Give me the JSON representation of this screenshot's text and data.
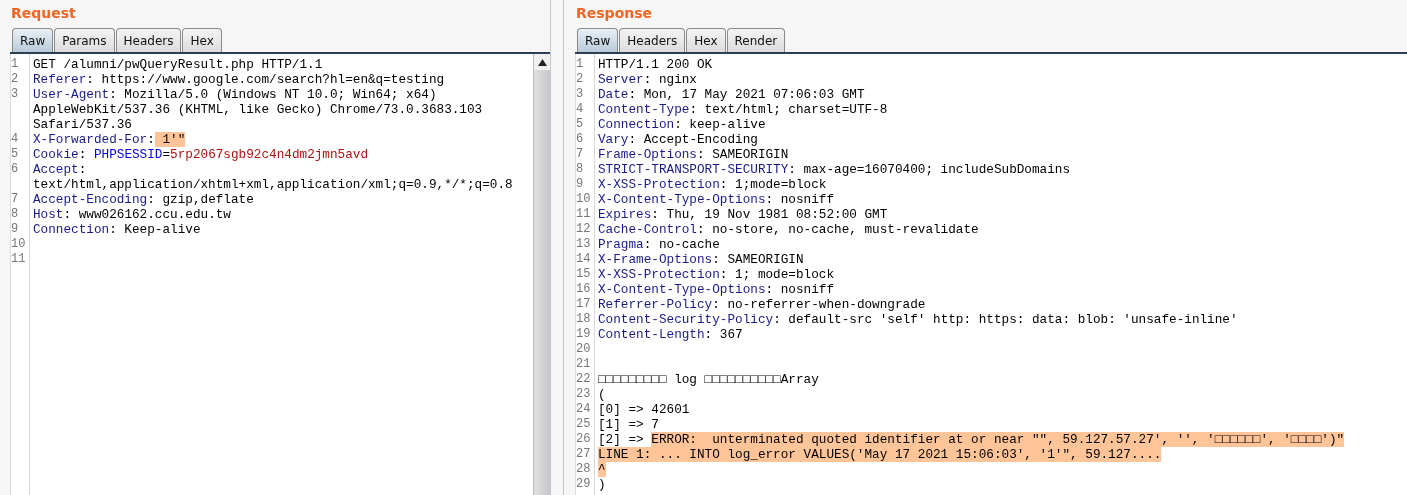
{
  "panes": [
    {
      "title": "Request",
      "scrollbar": true,
      "tabs": [
        {
          "label": "Raw",
          "selected": true
        },
        {
          "label": "Params",
          "selected": false
        },
        {
          "label": "Headers",
          "selected": false
        },
        {
          "label": "Hex",
          "selected": false
        }
      ],
      "lines": [
        {
          "number": "1",
          "rows": [
            [
              {
                "kind": "plain",
                "text": "GET /alumni/pwQueryResult.php HTTP/1.1"
              }
            ]
          ]
        },
        {
          "number": "2",
          "rows": [
            [
              {
                "kind": "name",
                "text": "Referer"
              },
              {
                "kind": "plain",
                "text": ": https://www.google.com/search?hl=en&q=testing"
              }
            ]
          ]
        },
        {
          "number": "3",
          "rows": [
            [
              {
                "kind": "name",
                "text": "User-Agent"
              },
              {
                "kind": "plain",
                "text": ": Mozilla/5.0 (Windows NT 10.0; Win64; x64)"
              }
            ],
            [
              {
                "kind": "plain",
                "text": "AppleWebKit/537.36 (KHTML, like Gecko) Chrome/73.0.3683.103"
              }
            ],
            [
              {
                "kind": "plain",
                "text": "Safari/537.36"
              }
            ]
          ]
        },
        {
          "number": "4",
          "rows": [
            [
              {
                "kind": "name",
                "text": "X-Forwarded-For"
              },
              {
                "kind": "plain",
                "text": ":"
              },
              {
                "kind": "highlight",
                "text": " 1'\""
              }
            ]
          ]
        },
        {
          "number": "5",
          "rows": [
            [
              {
                "kind": "name",
                "text": "Cookie"
              },
              {
                "kind": "plain",
                "text": ": "
              },
              {
                "kind": "param",
                "text": "PHPSESSID"
              },
              {
                "kind": "plain",
                "text": "="
              },
              {
                "kind": "value",
                "text": "5rp2067sgb92c4n4dm2jmn5avd"
              }
            ]
          ]
        },
        {
          "number": "6",
          "rows": [
            [
              {
                "kind": "name",
                "text": "Accept"
              },
              {
                "kind": "plain",
                "text": ":"
              }
            ],
            [
              {
                "kind": "plain",
                "text": "text/html,application/xhtml+xml,application/xml;q=0.9,*/*;q=0.8"
              }
            ]
          ]
        },
        {
          "number": "7",
          "rows": [
            [
              {
                "kind": "name",
                "text": "Accept-Encoding"
              },
              {
                "kind": "plain",
                "text": ": gzip,deflate"
              }
            ]
          ]
        },
        {
          "number": "8",
          "rows": [
            [
              {
                "kind": "name",
                "text": "Host"
              },
              {
                "kind": "plain",
                "text": ": www026162.ccu.edu.tw"
              }
            ]
          ]
        },
        {
          "number": "9",
          "rows": [
            [
              {
                "kind": "name",
                "text": "Connection"
              },
              {
                "kind": "plain",
                "text": ": Keep-alive"
              }
            ]
          ]
        },
        {
          "number": "10",
          "rows": [
            []
          ]
        },
        {
          "number": "11",
          "rows": [
            []
          ]
        }
      ]
    },
    {
      "title": "Response",
      "scrollbar": false,
      "tabs": [
        {
          "label": "Raw",
          "selected": true
        },
        {
          "label": "Headers",
          "selected": false
        },
        {
          "label": "Hex",
          "selected": false
        },
        {
          "label": "Render",
          "selected": false
        }
      ],
      "lines": [
        {
          "number": "1",
          "rows": [
            [
              {
                "kind": "plain",
                "text": "HTTP/1.1 200 OK"
              }
            ]
          ]
        },
        {
          "number": "2",
          "rows": [
            [
              {
                "kind": "name",
                "text": "Server"
              },
              {
                "kind": "plain",
                "text": ": nginx"
              }
            ]
          ]
        },
        {
          "number": "3",
          "rows": [
            [
              {
                "kind": "name",
                "text": "Date"
              },
              {
                "kind": "plain",
                "text": ": Mon, 17 May 2021 07:06:03 GMT"
              }
            ]
          ]
        },
        {
          "number": "4",
          "rows": [
            [
              {
                "kind": "name",
                "text": "Content-Type"
              },
              {
                "kind": "plain",
                "text": ": text/html; charset=UTF-8"
              }
            ]
          ]
        },
        {
          "number": "5",
          "rows": [
            [
              {
                "kind": "name",
                "text": "Connection"
              },
              {
                "kind": "plain",
                "text": ": keep-alive"
              }
            ]
          ]
        },
        {
          "number": "6",
          "rows": [
            [
              {
                "kind": "name",
                "text": "Vary"
              },
              {
                "kind": "plain",
                "text": ": Accept-Encoding"
              }
            ]
          ]
        },
        {
          "number": "7",
          "rows": [
            [
              {
                "kind": "name",
                "text": "Frame-Options"
              },
              {
                "kind": "plain",
                "text": ": SAMEORIGIN"
              }
            ]
          ]
        },
        {
          "number": "8",
          "rows": [
            [
              {
                "kind": "name",
                "text": "STRICT-TRANSPORT-SECURITY"
              },
              {
                "kind": "plain",
                "text": ": max-age=16070400; includeSubDomains"
              }
            ]
          ]
        },
        {
          "number": "9",
          "rows": [
            [
              {
                "kind": "name",
                "text": "X-XSS-Protection"
              },
              {
                "kind": "plain",
                "text": ": 1;mode=block"
              }
            ]
          ]
        },
        {
          "number": "10",
          "rows": [
            [
              {
                "kind": "name",
                "text": "X-Content-Type-Options"
              },
              {
                "kind": "plain",
                "text": ": nosniff"
              }
            ]
          ]
        },
        {
          "number": "11",
          "rows": [
            [
              {
                "kind": "name",
                "text": "Expires"
              },
              {
                "kind": "plain",
                "text": ": Thu, 19 Nov 1981 08:52:00 GMT"
              }
            ]
          ]
        },
        {
          "number": "12",
          "rows": [
            [
              {
                "kind": "name",
                "text": "Cache-Control"
              },
              {
                "kind": "plain",
                "text": ": no-store, no-cache, must-revalidate"
              }
            ]
          ]
        },
        {
          "number": "13",
          "rows": [
            [
              {
                "kind": "name",
                "text": "Pragma"
              },
              {
                "kind": "plain",
                "text": ": no-cache"
              }
            ]
          ]
        },
        {
          "number": "14",
          "rows": [
            [
              {
                "kind": "name",
                "text": "X-Frame-Options"
              },
              {
                "kind": "plain",
                "text": ": SAMEORIGIN"
              }
            ]
          ]
        },
        {
          "number": "15",
          "rows": [
            [
              {
                "kind": "name",
                "text": "X-XSS-Protection"
              },
              {
                "kind": "plain",
                "text": ": 1; mode=block"
              }
            ]
          ]
        },
        {
          "number": "16",
          "rows": [
            [
              {
                "kind": "name",
                "text": "X-Content-Type-Options"
              },
              {
                "kind": "plain",
                "text": ": nosniff"
              }
            ]
          ]
        },
        {
          "number": "17",
          "rows": [
            [
              {
                "kind": "name",
                "text": "Referrer-Policy"
              },
              {
                "kind": "plain",
                "text": ": no-referrer-when-downgrade"
              }
            ]
          ]
        },
        {
          "number": "18",
          "rows": [
            [
              {
                "kind": "name",
                "text": "Content-Security-Policy"
              },
              {
                "kind": "plain",
                "text": ": default-src 'self' http: https: data: blob: 'unsafe-inline'"
              }
            ]
          ]
        },
        {
          "number": "19",
          "rows": [
            [
              {
                "kind": "name",
                "text": "Content-Length"
              },
              {
                "kind": "plain",
                "text": ": 367"
              }
            ]
          ]
        },
        {
          "number": "20",
          "rows": [
            []
          ]
        },
        {
          "number": "21",
          "rows": [
            []
          ]
        },
        {
          "number": "22",
          "rows": [
            [
              {
                "kind": "plain",
                "text": "□□□□□□□□□ log □□□□□□□□□□Array"
              }
            ]
          ]
        },
        {
          "number": "23",
          "rows": [
            [
              {
                "kind": "plain",
                "text": "("
              }
            ]
          ]
        },
        {
          "number": "24",
          "rows": [
            [
              {
                "kind": "plain",
                "text": "[0] => 42601"
              }
            ]
          ]
        },
        {
          "number": "25",
          "rows": [
            [
              {
                "kind": "plain",
                "text": "[1] => 7"
              }
            ]
          ]
        },
        {
          "number": "26",
          "rows": [
            [
              {
                "kind": "plain",
                "text": "[2] => "
              },
              {
                "kind": "highlight",
                "text": "ERROR:  unterminated quoted identifier at or near \"\", 59.127.57.27', '', '□□□□□□', '□□□□')\""
              }
            ]
          ]
        },
        {
          "number": "27",
          "rows": [
            [
              {
                "kind": "highlight",
                "text": "LINE 1: ... INTO log_error VALUES('May 17 2021 15:06:03', '1'\", 59.127...."
              }
            ]
          ]
        },
        {
          "number": "28",
          "rows": [
            [
              {
                "kind": "highlight",
                "text": "^"
              }
            ]
          ]
        },
        {
          "number": "29",
          "rows": [
            [
              {
                "kind": "plain",
                "text": ")"
              }
            ]
          ]
        }
      ]
    }
  ]
}
